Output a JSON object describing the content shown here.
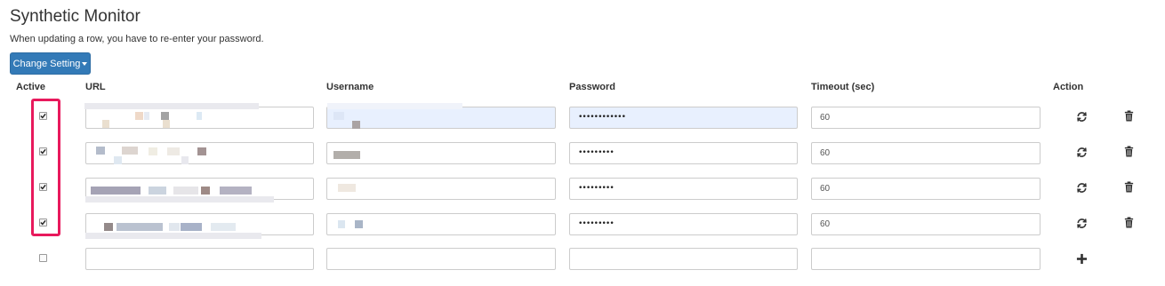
{
  "page": {
    "title": "Synthetic Monitor",
    "subtitle": "When updating a row, you have to re-enter your password.",
    "change_setting_label": "Change Setting"
  },
  "table": {
    "headers": {
      "active": "Active",
      "url": "URL",
      "username": "Username",
      "password": "Password",
      "timeout": "Timeout (sec)",
      "action": "Action"
    },
    "rows": [
      {
        "active": true,
        "url": "",
        "username": "",
        "password": "••••••••••••",
        "timeout": "60"
      },
      {
        "active": true,
        "url": "",
        "username": "",
        "password": "•••••••••",
        "timeout": "60"
      },
      {
        "active": true,
        "url": "",
        "username": "",
        "password": "•••••••••",
        "timeout": "60"
      },
      {
        "active": true,
        "url": "",
        "username": "",
        "password": "•••••••••",
        "timeout": "60"
      }
    ],
    "new_row": {
      "active": false,
      "url": "",
      "username": "",
      "password": "",
      "timeout": ""
    }
  },
  "icons": {
    "refresh": "refresh-icon",
    "delete": "trash-icon",
    "add": "plus-icon",
    "dropdown": "caret-down-icon"
  },
  "colors": {
    "primary_button": "#337ab7",
    "highlight_box": "#e8195c",
    "autofill_field": "#e8f0fe"
  }
}
